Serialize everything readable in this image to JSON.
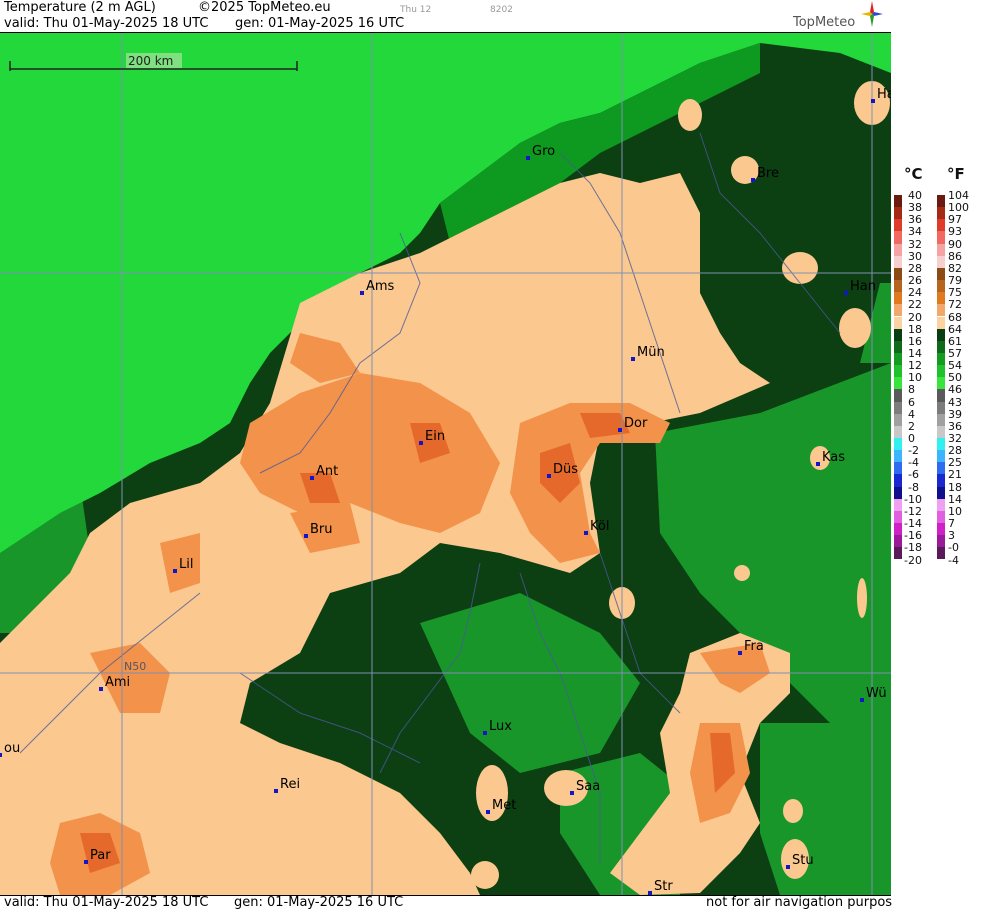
{
  "header": {
    "title": "Temperature (2 m AGL)",
    "copyright": "©2025 TopMeteo.eu",
    "valid": "valid:  Thu  01-May-2025  18 UTC",
    "gen": "gen: 01-May-2025 16 UTC",
    "day_code": "Thu 12",
    "code": "8202",
    "logo": "TopMeteo"
  },
  "footer": {
    "valid": "valid:  Thu  01-May-2025  18 UTC",
    "gen": "gen: 01-May-2025 16 UTC",
    "disclaimer": "not for air navigation purposes"
  },
  "map": {
    "scale_label": "200 km",
    "lat_label": "N50",
    "cities": [
      {
        "name": "Gro"
      },
      {
        "name": "Ha"
      },
      {
        "name": "Bre"
      },
      {
        "name": "Ams"
      },
      {
        "name": "Han"
      },
      {
        "name": "Mün"
      },
      {
        "name": "Ein"
      },
      {
        "name": "Dor"
      },
      {
        "name": "Ant"
      },
      {
        "name": "Düs"
      },
      {
        "name": "Kas"
      },
      {
        "name": "Bru"
      },
      {
        "name": "Köl"
      },
      {
        "name": "Lil"
      },
      {
        "name": "Fra"
      },
      {
        "name": "Ami"
      },
      {
        "name": "Wü"
      },
      {
        "name": "Lux"
      },
      {
        "name": "Saa"
      },
      {
        "name": "Rei"
      },
      {
        "name": "Met"
      },
      {
        "name": "Par"
      },
      {
        "name": "Stu"
      },
      {
        "name": "Str"
      },
      {
        "name": "ou"
      }
    ]
  },
  "legend": {
    "unit_c": "°C",
    "unit_f": "°F",
    "celsius": [
      "40",
      "38",
      "36",
      "34",
      "32",
      "30",
      "28",
      "26",
      "24",
      "22",
      "20",
      "18",
      "16",
      "14",
      "12",
      "10",
      "8",
      "6",
      "4",
      "2",
      "0",
      "-2",
      "-4",
      "-6",
      "-8",
      "-10",
      "-12",
      "-14",
      "-16",
      "-18",
      "-20"
    ],
    "fahrenheit": [
      "104",
      "100",
      "97",
      "93",
      "90",
      "86",
      "82",
      "79",
      "75",
      "72",
      "68",
      "64",
      "61",
      "57",
      "54",
      "50",
      "46",
      "43",
      "39",
      "36",
      "32",
      "28",
      "25",
      "21",
      "18",
      "14",
      "10",
      "7",
      "3",
      "-0",
      "-4"
    ],
    "colors": [
      "#6b1a10",
      "#a52a16",
      "#e03a28",
      "#f06a62",
      "#f4a4a4",
      "#f8cfcf",
      "#8a4b14",
      "#b5651d",
      "#e07a1e",
      "#f2a86a",
      "#fbd2a0",
      "#0b3d12",
      "#0f6a1a",
      "#159a22",
      "#1fc12c",
      "#39e53c",
      "#5a5a5a",
      "#7c7c7c",
      "#a0a0a0",
      "#c8c8c8",
      "#33f0f0",
      "#3cb4ff",
      "#2d6cf0",
      "#1a28d0",
      "#10108e",
      "#f0a0f0",
      "#e060e0",
      "#d020c8",
      "#9a1a9a",
      "#5a1a5a"
    ],
    "tick_indices": [
      0,
      1,
      2,
      3,
      4,
      5,
      6,
      7,
      8,
      9,
      10,
      11,
      12,
      13,
      14,
      15,
      16,
      17,
      18,
      19,
      20,
      21,
      22,
      23,
      24,
      25,
      26,
      27,
      28,
      29,
      30
    ]
  },
  "colors": {
    "sea": "#22d83b",
    "sea_deep": "#0e9920",
    "land_cool": "#0c3f12",
    "land_mid": "#18962a",
    "land_warm": "#fbc88f",
    "land_hot": "#f3924a",
    "land_hotter": "#e5692a"
  }
}
